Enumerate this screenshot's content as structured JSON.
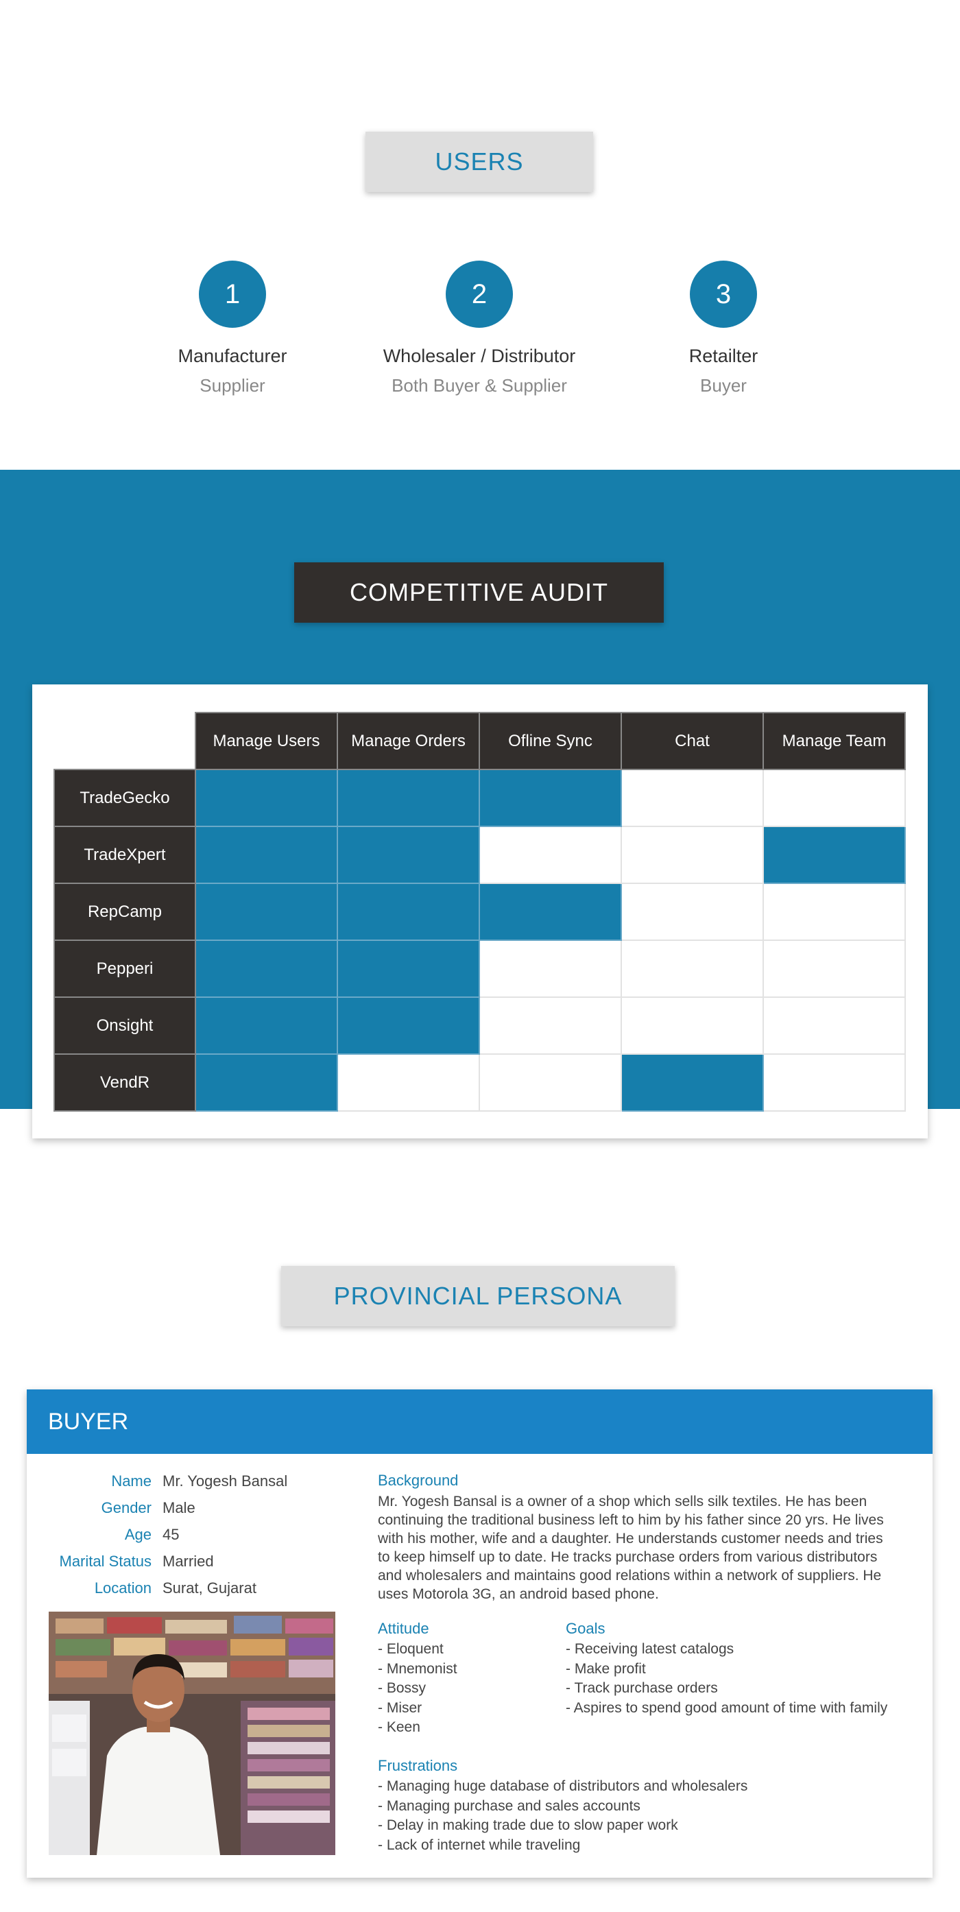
{
  "users": {
    "title": "USERS",
    "items": [
      {
        "number": "1",
        "role": "Manufacturer",
        "sub": "Supplier"
      },
      {
        "number": "2",
        "role": "Wholesaler / Distributor",
        "sub": "Both Buyer & Supplier"
      },
      {
        "number": "3",
        "role": "Retailter",
        "sub": "Buyer"
      }
    ]
  },
  "audit": {
    "title": "COMPETITIVE AUDIT",
    "columns": [
      "Manage Users",
      "Manage Orders",
      "Ofline Sync",
      "Chat",
      "Manage Team"
    ],
    "rows": [
      {
        "name": "TradeGecko",
        "features": [
          true,
          true,
          true,
          false,
          false
        ]
      },
      {
        "name": "TradeXpert",
        "features": [
          true,
          true,
          false,
          false,
          true
        ]
      },
      {
        "name": "RepCamp",
        "features": [
          true,
          true,
          true,
          false,
          false
        ]
      },
      {
        "name": "Pepperi",
        "features": [
          true,
          true,
          false,
          false,
          false
        ]
      },
      {
        "name": "Onsight",
        "features": [
          true,
          true,
          false,
          false,
          false
        ]
      },
      {
        "name": "VendR",
        "features": [
          true,
          false,
          false,
          true,
          false
        ]
      }
    ],
    "colors": {
      "on": "#167eab",
      "off": "#ffffff",
      "header": "#322e2c"
    }
  },
  "persona": {
    "title": "PROVINCIAL PERSONA",
    "header": "BUYER",
    "info": [
      {
        "key": "Name",
        "value": "Mr. Yogesh Bansal"
      },
      {
        "key": "Gender",
        "value": "Male"
      },
      {
        "key": "Age",
        "value": "45"
      },
      {
        "key": "Marital Status",
        "value": "Married"
      },
      {
        "key": "Location",
        "value": "Surat, Gujarat"
      }
    ],
    "background_heading": "Background",
    "background_lines": [
      "Mr. Yogesh Bansal is a owner of a shop which sells silk textiles. He has been",
      "continuing the traditional business left to him by his father since 20 yrs. He lives",
      "with his mother, wife and a daughter. He understands customer needs and tries",
      "to keep himself up to date. He tracks purchase orders from various distributors",
      "and wholesalers and maintains good relations within a network of suppliers. He",
      "uses Motorola 3G, an android based phone."
    ],
    "attitude_heading": "Attitude",
    "attitude": [
      "- Eloquent",
      "- Mnemonist",
      "- Bossy",
      "- Miser",
      "- Keen"
    ],
    "goals_heading": "Goals",
    "goals": [
      "- Receiving latest catalogs",
      "- Make profit",
      "- Track purchase orders",
      "- Aspires to spend good amount of time with family"
    ],
    "frustrations_heading": "Frustrations",
    "frustrations": [
      "- Managing huge database of distributors and wholesalers",
      "- Managing purchase and sales accounts",
      "- Delay in making trade due to slow paper work",
      "- Lack of internet while traveling"
    ]
  },
  "colors": {
    "accent": "#167eab",
    "dark": "#322e2c",
    "light_button": "#dedede",
    "persona_header": "#1a83c6"
  }
}
